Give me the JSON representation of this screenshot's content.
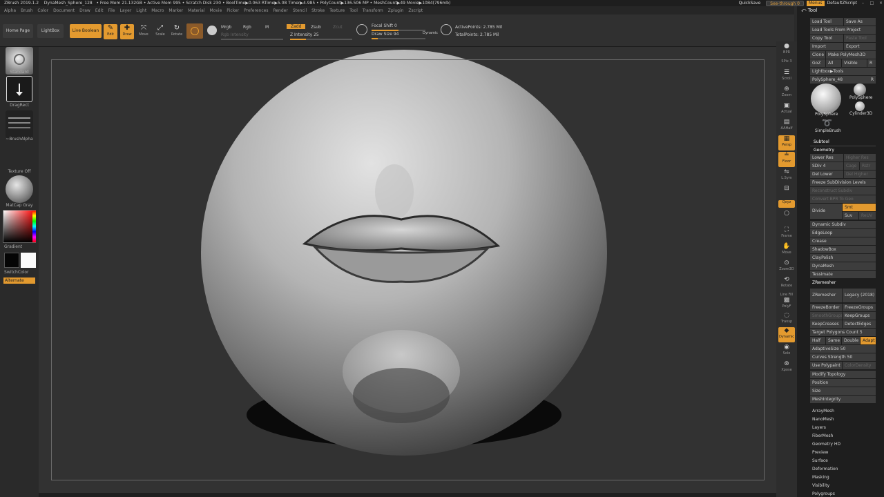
{
  "title_bar": {
    "app": "ZBrush 2019.1.2",
    "document": "DynaMesh_Sphere_128",
    "stats": "• Free Mem 21.132GB • Active Mem 995 • Scratch Disk 230 • BoolTime▶0.063 RTime▶5.08 Timer▶4.985 • PolyCount▶136.506 MP • MeshCount▶49  Movie▶1084(796mb)",
    "quicksave": "QuickSave",
    "see_through": "See-through  0",
    "menus": "Menus",
    "default_script": "DefaultZScript"
  },
  "menu": [
    "Alpha",
    "Brush",
    "Color",
    "Document",
    "Draw",
    "Edit",
    "File",
    "Layer",
    "Light",
    "Macro",
    "Marker",
    "Material",
    "Movie",
    "Picker",
    "Preferences",
    "Render",
    "Stencil",
    "Stroke",
    "Texture",
    "Tool",
    "Transform",
    "Zplugin",
    "Zscript"
  ],
  "shelf": {
    "home_page": "Home Page",
    "lightbox": "LightBox",
    "live_boolean": "Live Boolean",
    "edit": "Edit",
    "draw": "Draw",
    "move": "Move",
    "scale": "Scale",
    "rotate": "Rotate",
    "mrgb": "Mrgb",
    "rgb": "Rgb",
    "m": "M",
    "rgb_intensity": "Rgb Intensity",
    "zadd": "Zadd",
    "zsub": "Zsub",
    "zcut": "Zcut",
    "z_intensity_label": "Z Intensity",
    "z_intensity_value": "25",
    "focal_shift_label": "Focal Shift",
    "focal_shift_value": "0",
    "draw_size_label": "Draw Size",
    "draw_size_value": "94",
    "dynamic": "Dynamic",
    "active_points": "ActivePoints: 2.785 Mil",
    "total_points": "TotalPoints: 2.785 Mil"
  },
  "left": {
    "brush": "Standard",
    "stroke": "DragRect",
    "alpha": "~BrushAlpha",
    "texture": "Texture Off",
    "material": "MatCap Gray",
    "gradient": "Gradient",
    "swatch": "SwitchColor",
    "alternate": "Alternate"
  },
  "right_shelf": {
    "bpr": "BPR",
    "spix_label": "SPix",
    "spix_value": "3",
    "scroll": "Scroll",
    "zoom": "Zoom",
    "actual": "Actual",
    "aahalf": "AAHalf",
    "persp": "Persp",
    "floor": "Floor",
    "lsym": "L.Sym",
    "xyz": "Qxyz",
    "frame": "Frame",
    "move": "Move",
    "zoom3d": "Zoom3D",
    "rotate": "Rotate",
    "linefill": "Line Fill",
    "polyf": "PolyF",
    "transp": "Transp",
    "dynamic": "Dynamic",
    "solo": "Solo",
    "xpose": "Xpose"
  },
  "palette": {
    "title": "Tool",
    "load_tool": "Load Tool",
    "save_as": "Save As",
    "load_from_project": "Load Tools From Project",
    "copy_tool": "Copy Tool",
    "paste_tool": "Paste Tool",
    "import": "Import",
    "export": "Export",
    "clone": "Clone",
    "make_polymesh": "Make PolyMesh3D",
    "goz": "GoZ",
    "all": "All",
    "visible": "Visible",
    "r": "R",
    "lightbox_tools": "Lightbox▶Tools",
    "polysphere_slider": "PolySphere_48",
    "thumb_polysphere": "PolySphere",
    "thumb_polysphere2": "PolySphere",
    "thumb_cylinder": "Cylinder3D",
    "thumb_simplebrush": "SimpleBrush",
    "subtool": "Subtool",
    "geometry": "Geometry",
    "lower_res": "Lower Res",
    "higher_res": "Higher Res",
    "sdiv_label": "SDiv",
    "sdiv_value": "4",
    "cage": "Cage",
    "rstr": "Rstr",
    "del_lower": "Del Lower",
    "del_higher": "Del Higher",
    "freeze_subdiv": "Freeze SubDivision Levels",
    "reconstruct": "Reconstruct Subdiv",
    "convert_bpr": "Convert BPR To Geo",
    "divide": "Divide",
    "smt": "Smt",
    "suv": "Suv",
    "reuv": "ReUV",
    "dynamic_subdiv": "Dynamic Subdiv",
    "edgeloop": "EdgeLoop",
    "crease": "Crease",
    "shadowbox": "ShadowBox",
    "claypolish": "ClayPolish",
    "dynamesh": "DynaMesh",
    "tessimate": "Tessimate",
    "zremesher_sec": "ZRemesher",
    "zremesher_btn": "ZRemesher",
    "legacy": "Legacy (2018)",
    "freeze_border": "FreezeBorder",
    "freeze_groups": "FreezeGroups",
    "smooth_groups": "SmoothGroups",
    "keep_groups": "KeepGroups",
    "keep_creases": "KeepCreases",
    "detect_edges": "DetectEdges",
    "target_poly_label": "Target Polygons Count",
    "target_poly_value": "5",
    "half": "Half",
    "same": "Same",
    "double": "Double",
    "adapt": "Adapt",
    "adaptive_size_label": "AdaptiveSize",
    "adaptive_size_value": "50",
    "curves_strength_label": "Curves Strength",
    "curves_strength_value": "50",
    "use_polypaint": "Use Polypaint",
    "color_density": "ColorDensity",
    "modify_topology": "Modify Topology",
    "position": "Position",
    "size": "Size",
    "mesh_integrity": "MeshIntegrity",
    "subpalettes": [
      "ArrayMesh",
      "NanoMesh",
      "Layers",
      "FiberMesh",
      "Geometry HD",
      "Preview",
      "Surface",
      "Deformation",
      "Masking",
      "Visibility",
      "Polygroups"
    ]
  },
  "colors": {
    "accent": "#e39a2f",
    "bg": "#2b2b2b",
    "palette_bg": "#1e1e1e"
  }
}
